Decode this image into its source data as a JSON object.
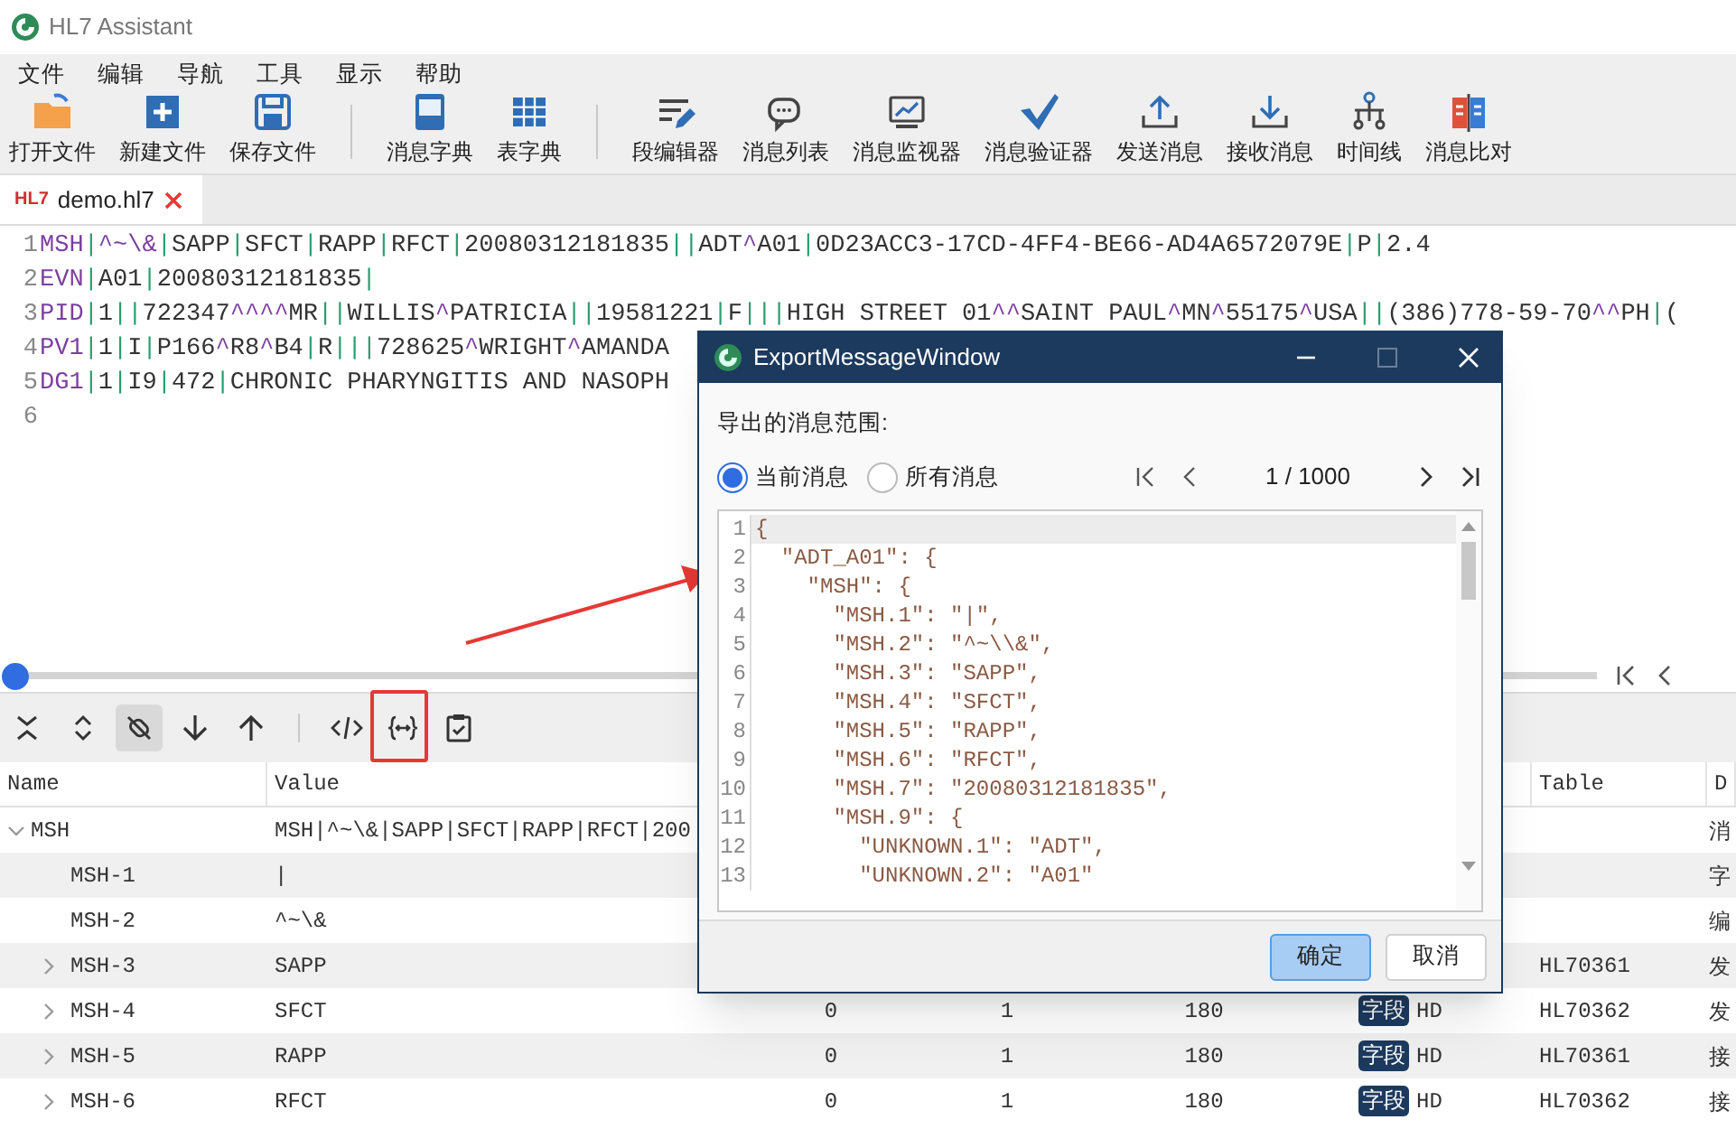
{
  "window": {
    "title": "HL7 Assistant"
  },
  "menu": [
    "文件",
    "编辑",
    "导航",
    "工具",
    "显示",
    "帮助"
  ],
  "toolbar": [
    [
      {
        "label": "打开文件"
      },
      {
        "label": "新建文件"
      },
      {
        "label": "保存文件"
      }
    ],
    [
      {
        "label": "消息字典"
      },
      {
        "label": "表字典"
      }
    ],
    [
      {
        "label": "段编辑器"
      },
      {
        "label": "消息列表"
      },
      {
        "label": "消息监视器"
      },
      {
        "label": "消息验证器"
      },
      {
        "label": "发送消息"
      },
      {
        "label": "接收消息"
      },
      {
        "label": "时间线"
      },
      {
        "label": "消息比对"
      }
    ]
  ],
  "tabs": [
    {
      "badge": "HL7",
      "label": "demo.hl7",
      "selected": true
    }
  ],
  "editor": {
    "lines": [
      {
        "number": "1",
        "text": "MSH|^~\\&|SAPP|SFCT|RAPP|RFCT|20080312181835||ADT^A01|0D23ACC3-17CD-4FF4-BE66-AD4A6572079E|P|2.4"
      },
      {
        "number": "2",
        "text": "EVN|A01|20080312181835|"
      },
      {
        "number": "3",
        "text": "PID|1||722347^^^^MR||WILLIS^PATRICIA||19581221|F|||HIGH STREET 01^^SAINT PAUL^MN^55175^USA||(386)778-59-70^^PH|("
      },
      {
        "number": "4",
        "text": "PV1|1|I|P166^R8^B4|R|||728625^WRIGHT^AMANDA"
      },
      {
        "number": "5",
        "text": "DG1|1|I9|472|CHRONIC PHARYNGITIS AND NASOPH"
      },
      {
        "number": "6"
      }
    ]
  },
  "segment_toolbar": [
    {
      "active": false
    },
    {
      "active": false
    },
    {
      "active": true
    },
    {
      "active": false
    },
    {
      "active": false
    },
    {
      "active": false
    },
    {
      "active": false
    },
    {
      "active": false
    }
  ],
  "tree_table": {
    "columns": [
      "Name",
      "Value",
      "Table",
      "D"
    ],
    "rows": [
      {
        "name": "MSH",
        "value": "MSH|^~\\&|SAPP|SFCT|RAPP|RFCT|200",
        "column_8": "消",
        "expanded": true,
        "children": [
          {
            "name": "MSH-1",
            "value": "|",
            "column_8": "字",
            "expandable": false
          },
          {
            "name": "MSH-2",
            "value": "^~\\&",
            "column_8": "编",
            "expandable": false
          },
          {
            "name": "MSH-3",
            "value": "SAPP",
            "table": "HL70361",
            "column_8": "发",
            "expandable": true
          },
          {
            "name": "MSH-4",
            "value": "SFCT",
            "column_3": "0",
            "column_4": "1",
            "column_5": "180",
            "badge": "字段",
            "column_6": "HD",
            "table": "HL70362",
            "column_8": "发",
            "expandable": true
          },
          {
            "name": "MSH-5",
            "value": "RAPP",
            "column_3": "0",
            "column_4": "1",
            "column_5": "180",
            "badge": "字段",
            "column_6": "HD",
            "table": "HL70361",
            "column_8": "接",
            "expandable": true
          },
          {
            "name": "MSH-6",
            "value": "RFCT",
            "column_3": "0",
            "column_4": "1",
            "column_5": "180",
            "badge": "字段",
            "column_6": "HD",
            "table": "HL70362",
            "column_8": "接",
            "expandable": true
          }
        ]
      }
    ]
  },
  "dialog": {
    "title": "ExportMessageWindow",
    "range_label": "导出的消息范围:",
    "scope": [
      {
        "label": "当前消息",
        "selected": true
      },
      {
        "label": "所有消息",
        "selected": false
      }
    ],
    "pager": "1 / 1000",
    "code_lines": [
      {
        "number": "1",
        "text": "{",
        "current": true
      },
      {
        "number": "2",
        "text": "  \"ADT_A01\": {",
        "current": false
      },
      {
        "number": "3",
        "text": "    \"MSH\": {",
        "current": false
      },
      {
        "number": "4",
        "text": "      \"MSH.1\": \"|\",",
        "current": false
      },
      {
        "number": "5",
        "text": "      \"MSH.2\": \"^~\\\\&\",",
        "current": false
      },
      {
        "number": "6",
        "text": "      \"MSH.3\": \"SAPP\",",
        "current": false
      },
      {
        "number": "7",
        "text": "      \"MSH.4\": \"SFCT\",",
        "current": false
      },
      {
        "number": "8",
        "text": "      \"MSH.5\": \"RAPP\",",
        "current": false
      },
      {
        "number": "9",
        "text": "      \"MSH.6\": \"RFCT\",",
        "current": false
      },
      {
        "number": "10",
        "text": "      \"MSH.7\": \"20080312181835\",",
        "current": false
      },
      {
        "number": "11",
        "text": "      \"MSH.9\": {",
        "current": false
      },
      {
        "number": "12",
        "text": "        \"UNKNOWN.1\": \"ADT\",",
        "current": false
      },
      {
        "number": "13",
        "text": "        \"UNKNOWN.2\": \"A01\"",
        "current": false
      }
    ],
    "buttons": [
      {
        "label": "确定",
        "default": true
      },
      {
        "label": "取消",
        "default": false
      }
    ]
  }
}
